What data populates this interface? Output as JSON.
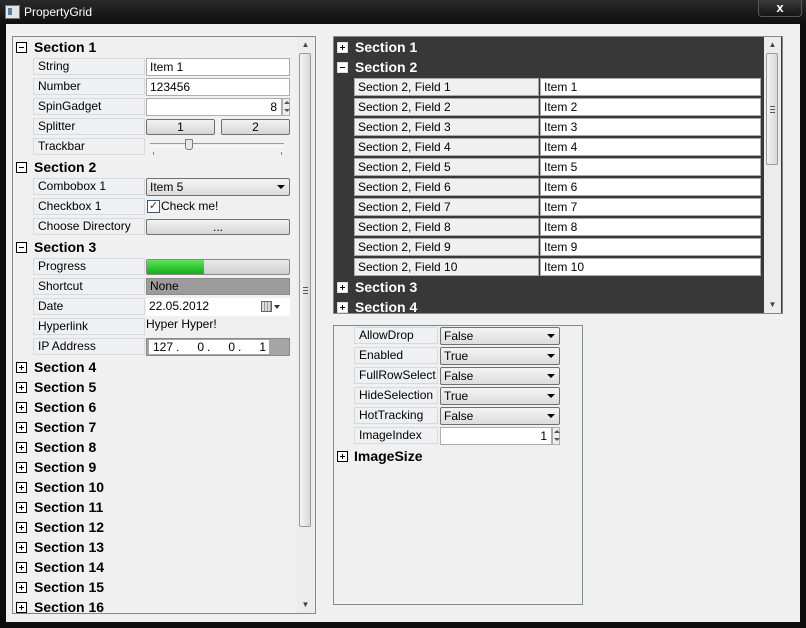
{
  "window": {
    "title": "PropertyGrid",
    "close_glyph": "x"
  },
  "left": {
    "section1": {
      "title": "Section 1",
      "string_label": "String",
      "string_value": "Item 1",
      "number_label": "Number",
      "number_value": "123456",
      "spin_label": "SpinGadget",
      "spin_value": "8",
      "splitter_label": "Splitter",
      "splitter_btn1": "1",
      "splitter_btn2": "2",
      "trackbar_label": "Trackbar"
    },
    "section2": {
      "title": "Section 2",
      "combobox_label": "Combobox 1",
      "combobox_value": "Item 5",
      "checkbox_label": "Checkbox 1",
      "checkbox_text": "Check me!",
      "directory_label": "Choose Directory",
      "directory_button": "..."
    },
    "section3": {
      "title": "Section 3",
      "progress_label": "Progress",
      "progress_fraction": 0.4,
      "shortcut_label": "Shortcut",
      "shortcut_value": "None",
      "date_label": "Date",
      "date_value": "22.05.2012",
      "hyperlink_label": "Hyperlink",
      "hyperlink_value": "Hyper Hyper!",
      "ip_label": "IP Address",
      "ip_octets": [
        "127",
        "0",
        "0",
        "1"
      ],
      "ip_separator": "."
    },
    "collapsed_sections": [
      "Section 4",
      "Section 5",
      "Section 6",
      "Section 7",
      "Section 8",
      "Section 9",
      "Section 10",
      "Section 11",
      "Section 12",
      "Section 13",
      "Section 14",
      "Section 15",
      "Section 16"
    ]
  },
  "right_top": {
    "section1": "Section 1",
    "section2": "Section 2",
    "fields": [
      {
        "label": "Section 2, Field 1",
        "value": "Item 1"
      },
      {
        "label": "Section 2, Field 2",
        "value": "Item 2"
      },
      {
        "label": "Section 2, Field 3",
        "value": "Item 3"
      },
      {
        "label": "Section 2, Field 4",
        "value": "Item 4"
      },
      {
        "label": "Section 2, Field 5",
        "value": "Item 5"
      },
      {
        "label": "Section 2, Field 6",
        "value": "Item 6"
      },
      {
        "label": "Section 2, Field 7",
        "value": "Item 7"
      },
      {
        "label": "Section 2, Field 8",
        "value": "Item 8"
      },
      {
        "label": "Section 2, Field 9",
        "value": "Item 9"
      },
      {
        "label": "Section 2, Field 10",
        "value": "Item 10"
      }
    ],
    "section3": "Section 3",
    "section4": "Section 4"
  },
  "right_bottom": {
    "props": [
      {
        "label": "AllowDrop",
        "value": "False"
      },
      {
        "label": "Enabled",
        "value": "True"
      },
      {
        "label": "FullRowSelect",
        "value": "False"
      },
      {
        "label": "HideSelection",
        "value": "True"
      },
      {
        "label": "HotTracking",
        "value": "False"
      }
    ],
    "imageindex_label": "ImageIndex",
    "imageindex_value": "1",
    "imagesize_label": "ImageSize"
  },
  "icons": {
    "expand": "plus-box-icon",
    "collapse": "minus-box-icon",
    "scroll_up": "arrow-up-icon",
    "scroll_down": "arrow-down-icon",
    "calendar": "calendar-icon",
    "close": "close-icon"
  },
  "colors": {
    "dark_panel": "#383838",
    "progress_green": "#1ec21e",
    "shortcut_bg": "#9c9c9c"
  }
}
